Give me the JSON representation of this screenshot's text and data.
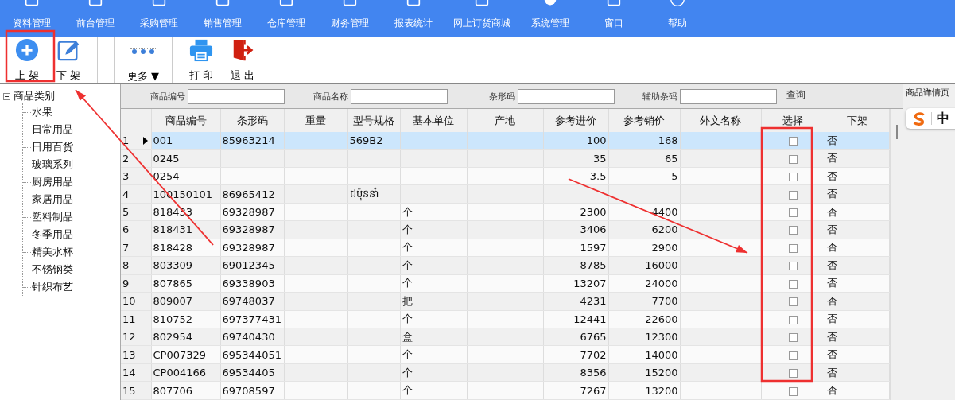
{
  "menu": [
    {
      "label": "资料管理"
    },
    {
      "label": "前台管理"
    },
    {
      "label": "采购管理"
    },
    {
      "label": "销售管理"
    },
    {
      "label": "仓库管理"
    },
    {
      "label": "财务管理"
    },
    {
      "label": "报表统计"
    },
    {
      "label": "网上订货商城"
    },
    {
      "label": "系统管理"
    },
    {
      "label": "窗口"
    },
    {
      "label": "帮助"
    }
  ],
  "toolbar": [
    {
      "label": "上 架",
      "kind": "add"
    },
    {
      "label": "下 架",
      "kind": "edit"
    },
    {
      "label": "更多 ▼",
      "kind": "more"
    },
    {
      "label": "打 印",
      "kind": "print"
    },
    {
      "label": "退 出",
      "kind": "exit"
    }
  ],
  "tree": {
    "label": "商品类别",
    "expanded": true,
    "children": [
      {
        "label": "水果"
      },
      {
        "label": "日常用品"
      },
      {
        "label": "日用百货"
      },
      {
        "label": "玻璃系列"
      },
      {
        "label": "厨房用品"
      },
      {
        "label": "家居用品"
      },
      {
        "label": "塑料制品"
      },
      {
        "label": "冬季用品"
      },
      {
        "label": "精美水杯"
      },
      {
        "label": "不锈钢类"
      },
      {
        "label": "针织布艺"
      }
    ]
  },
  "filters": [
    {
      "label": "商品编号"
    },
    {
      "label": "商品名称"
    },
    {
      "label": "条形码"
    },
    {
      "label": "辅助条码"
    }
  ],
  "query_button": "查询",
  "table": {
    "columns": [
      "商品编号",
      "条形码",
      "重量",
      "型号规格",
      "基本单位",
      "产地",
      "参考进价",
      "参考销价",
      "外文名称",
      "选择",
      "下架"
    ],
    "rows": [
      {
        "num": "1",
        "selected": true,
        "cells": [
          "001",
          "85963214",
          "",
          "569B2",
          "",
          "",
          "100",
          "168",
          ""
        ],
        "checked": false,
        "off_shelf": "否"
      },
      {
        "num": "2",
        "selected": false,
        "cells": [
          "0245",
          "",
          "",
          "",
          "",
          "",
          "35",
          "65",
          ""
        ],
        "checked": false,
        "off_shelf": "否"
      },
      {
        "num": "3",
        "selected": false,
        "cells": [
          "0254",
          "",
          "",
          "",
          "",
          "",
          "3.5",
          "5",
          ""
        ],
        "checked": false,
        "off_shelf": "否"
      },
      {
        "num": "4",
        "selected": false,
        "cells": [
          "100150101",
          "86965412",
          "",
          "ជប៉ុននាំ",
          "",
          "",
          "",
          "",
          ""
        ],
        "checked": false,
        "off_shelf": "否"
      },
      {
        "num": "5",
        "selected": false,
        "cells": [
          "818433",
          "69328987",
          "",
          "",
          "个",
          "",
          "2300",
          "4400",
          ""
        ],
        "checked": false,
        "off_shelf": "否"
      },
      {
        "num": "6",
        "selected": false,
        "cells": [
          "818431",
          "69328987",
          "",
          "",
          "个",
          "",
          "3406",
          "6200",
          ""
        ],
        "checked": false,
        "off_shelf": "否"
      },
      {
        "num": "7",
        "selected": false,
        "cells": [
          "818428",
          "69328987",
          "",
          "",
          "个",
          "",
          "1597",
          "2900",
          ""
        ],
        "checked": false,
        "off_shelf": "否"
      },
      {
        "num": "8",
        "selected": false,
        "cells": [
          "803309",
          "69012345",
          "",
          "",
          "个",
          "",
          "8785",
          "16000",
          ""
        ],
        "checked": false,
        "off_shelf": "否"
      },
      {
        "num": "9",
        "selected": false,
        "cells": [
          "807865",
          "69338903",
          "",
          "",
          "个",
          "",
          "13207",
          "24000",
          ""
        ],
        "checked": false,
        "off_shelf": "否"
      },
      {
        "num": "10",
        "selected": false,
        "cells": [
          "809007",
          "69748037",
          "",
          "",
          "把",
          "",
          "4231",
          "7700",
          ""
        ],
        "checked": false,
        "off_shelf": "否"
      },
      {
        "num": "11",
        "selected": false,
        "cells": [
          "810752",
          "697377431",
          "",
          "",
          "个",
          "",
          "12441",
          "22600",
          ""
        ],
        "checked": false,
        "off_shelf": "否"
      },
      {
        "num": "12",
        "selected": false,
        "cells": [
          "802954",
          "69740430",
          "",
          "",
          "盒",
          "",
          "6765",
          "12300",
          ""
        ],
        "checked": false,
        "off_shelf": "否"
      },
      {
        "num": "13",
        "selected": false,
        "cells": [
          "CP007329",
          "695344051",
          "",
          "",
          "个",
          "",
          "7702",
          "14000",
          ""
        ],
        "checked": false,
        "off_shelf": "否"
      },
      {
        "num": "14",
        "selected": false,
        "cells": [
          "CP004166",
          "69534405",
          "",
          "",
          "个",
          "",
          "8356",
          "15200",
          ""
        ],
        "checked": false,
        "off_shelf": "否"
      },
      {
        "num": "15",
        "selected": false,
        "cells": [
          "807706",
          "69708597",
          "",
          "",
          "个",
          "",
          "7267",
          "13200",
          ""
        ],
        "checked": false,
        "off_shelf": "否"
      }
    ]
  },
  "detail_panel": {
    "title": "商品详情页",
    "ime_label": "中"
  }
}
